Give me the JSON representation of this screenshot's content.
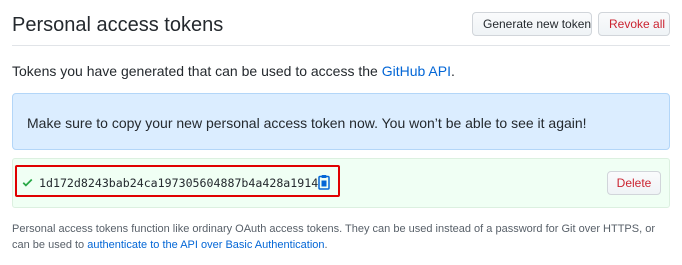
{
  "header": {
    "title": "Personal access tokens",
    "generate_label": "Generate new token",
    "revoke_label": "Revoke all"
  },
  "intro": {
    "text": "Tokens you have generated that can be used to access the ",
    "link": "GitHub API",
    "suffix": "."
  },
  "flash": {
    "message": "Make sure to copy your new personal access token now. You won’t be able to see it again!"
  },
  "token": {
    "value": "1d172d8243bab24ca197305604887b4a428a1914",
    "delete_label": "Delete"
  },
  "footnote": {
    "text": "Personal access tokens function like ordinary OAuth access tokens. They can be used instead of a password for Git over HTTPS, or can be used to ",
    "link": "authenticate to the API over Basic Authentication",
    "suffix": "."
  },
  "colors": {
    "link": "#0366d6",
    "danger": "#cb2431",
    "success": "#28a745",
    "info_bg": "#dbedff",
    "token_bg": "#f0fff4",
    "highlight": "#e00000"
  },
  "icons": {
    "check": "check-icon",
    "copy": "clipboard-icon"
  }
}
